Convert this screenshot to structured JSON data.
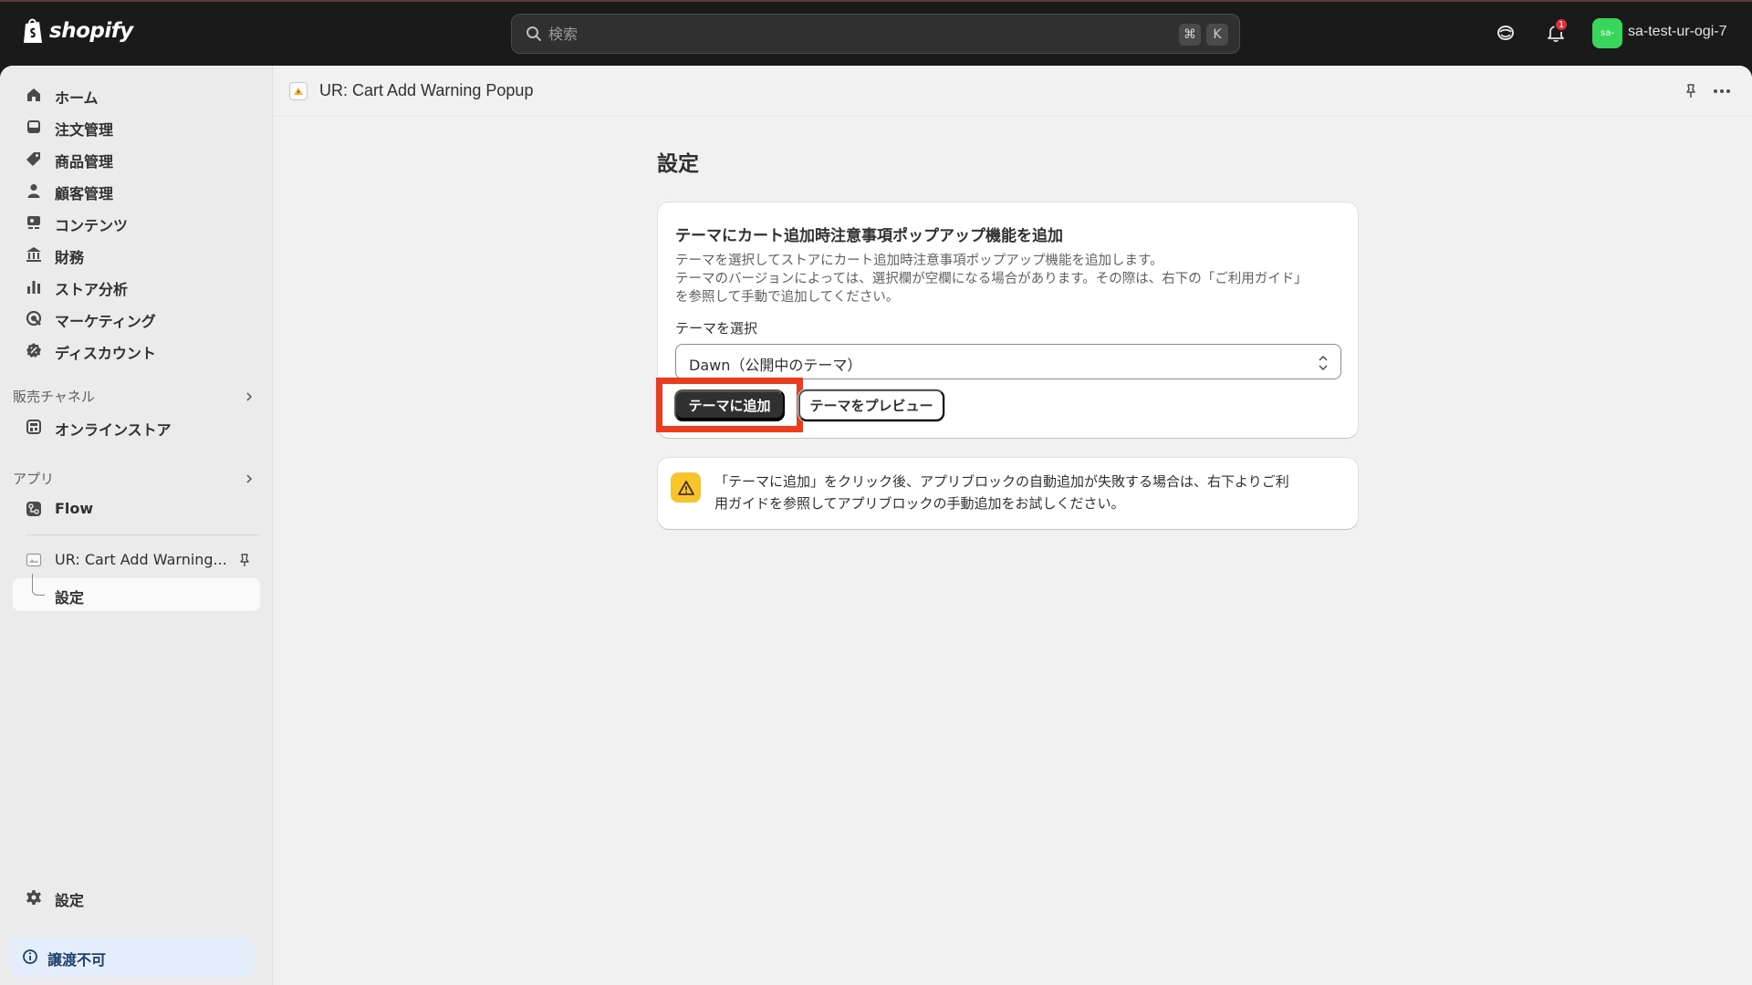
{
  "topbar": {
    "brand": "shopify",
    "search_placeholder": "検索",
    "shortcut_keys": [
      "⌘",
      "K"
    ],
    "notification_count": "1",
    "avatar_initials": "sa-",
    "store_name": "sa-test-ur-ogi-7"
  },
  "sidebar": {
    "items": [
      {
        "label": "ホーム",
        "icon": "home-icon"
      },
      {
        "label": "注文管理",
        "icon": "inbox-icon"
      },
      {
        "label": "商品管理",
        "icon": "tag-icon"
      },
      {
        "label": "顧客管理",
        "icon": "person-icon"
      },
      {
        "label": "コンテンツ",
        "icon": "content-icon"
      },
      {
        "label": "財務",
        "icon": "bank-icon"
      },
      {
        "label": "ストア分析",
        "icon": "bar-chart-icon"
      },
      {
        "label": "マーケティング",
        "icon": "target-icon"
      },
      {
        "label": "ディスカウント",
        "icon": "discount-icon"
      }
    ],
    "sales_channels_title": "販売チャネル",
    "online_store_label": "オンラインストア",
    "apps_title": "アプリ",
    "flow_label": "Flow",
    "app_label": "UR: Cart Add Warning...",
    "app_sub_label": "設定",
    "settings_label": "設定",
    "footer_label": "譲渡不可"
  },
  "header": {
    "app_title": "UR: Cart Add Warning Popup"
  },
  "page": {
    "title": "設定",
    "card": {
      "title": "テーマにカート追加時注意事項ポップアップ機能を追加",
      "desc_line1": "テーマを選択してストアにカート追加時注意事項ポップアップ機能を追加します。",
      "desc_line2": "テーマのバージョンによっては、選択欄が空欄になる場合があります。その際は、右下の「ご利用ガイド」",
      "desc_line3": "を参照して手動で追加してください。",
      "field_label": "テーマを選択",
      "select_value": "Dawn（公開中のテーマ）",
      "primary_button": "テーマに追加",
      "secondary_button": "テーマをプレビュー"
    },
    "notice": {
      "line1": "「テーマに追加」をクリック後、アプリブロックの自動追加が失敗する場合は、右下よりご利",
      "line2": "用ガイドを参照してアプリブロックの手動追加をお試しください。"
    }
  },
  "colors": {
    "highlight": "#ee3b1d",
    "warning": "#f7c52b",
    "avatar": "#38d65a",
    "badge": "#e22c38"
  }
}
